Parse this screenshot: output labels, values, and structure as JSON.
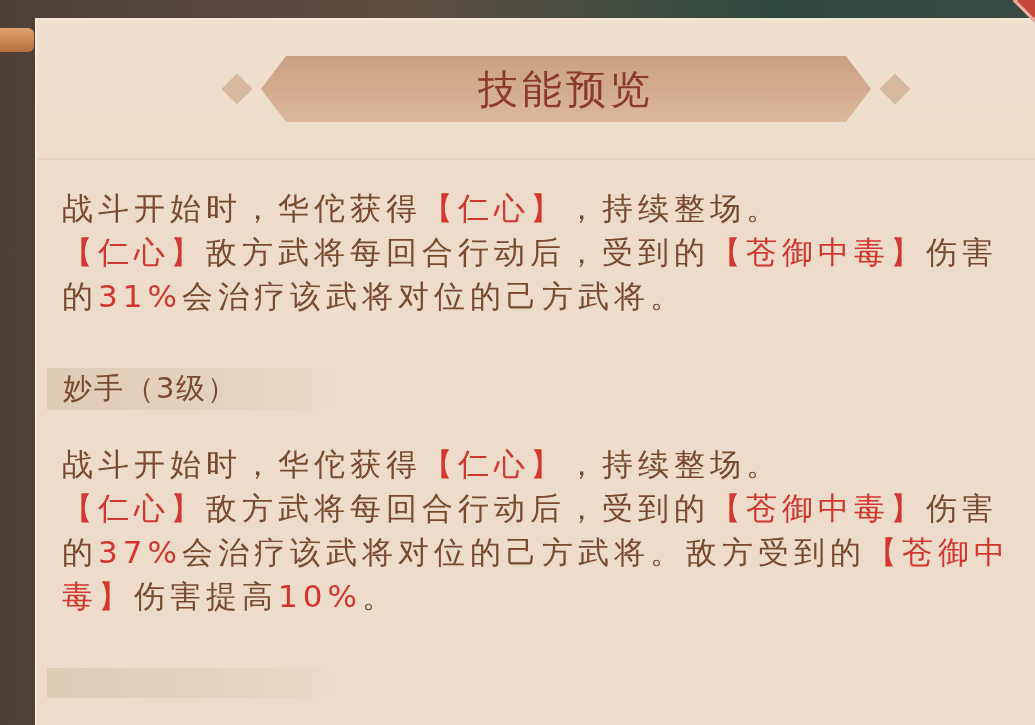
{
  "title": "技能预览",
  "items": [
    {
      "kind": "description",
      "paragraphs": [
        [
          {
            "text": "战斗开始时，华佗获得",
            "highlight": false
          },
          {
            "text": "【仁心】",
            "highlight": true
          },
          {
            "text": "，持续整场。",
            "highlight": false
          }
        ],
        [
          {
            "text": "【仁心】",
            "highlight": true
          },
          {
            "text": "敌方武将每回合行动后，受到的",
            "highlight": false
          },
          {
            "text": "【苍御中毒】",
            "highlight": true
          },
          {
            "text": "伤害的",
            "highlight": false
          },
          {
            "text": "31%",
            "highlight": true
          },
          {
            "text": "会治疗该武将对位的己方武将。",
            "highlight": false
          }
        ]
      ]
    },
    {
      "kind": "heading",
      "text": "妙手（3级）"
    },
    {
      "kind": "description",
      "paragraphs": [
        [
          {
            "text": "战斗开始时，华佗获得",
            "highlight": false
          },
          {
            "text": "【仁心】",
            "highlight": true
          },
          {
            "text": "，持续整场。",
            "highlight": false
          }
        ],
        [
          {
            "text": "【仁心】",
            "highlight": true
          },
          {
            "text": "敌方武将每回合行动后，受到的",
            "highlight": false
          },
          {
            "text": "【苍御中毒】",
            "highlight": true
          },
          {
            "text": "伤害的",
            "highlight": false
          },
          {
            "text": "37%",
            "highlight": true
          },
          {
            "text": "会治疗该武将对位的己方武将。敌方受到的",
            "highlight": false
          },
          {
            "text": "【苍御中毒】",
            "highlight": true
          },
          {
            "text": "伤害提高",
            "highlight": false
          },
          {
            "text": "10%",
            "highlight": true
          },
          {
            "text": "。",
            "highlight": false
          }
        ]
      ]
    },
    {
      "kind": "cut_heading"
    }
  ]
}
